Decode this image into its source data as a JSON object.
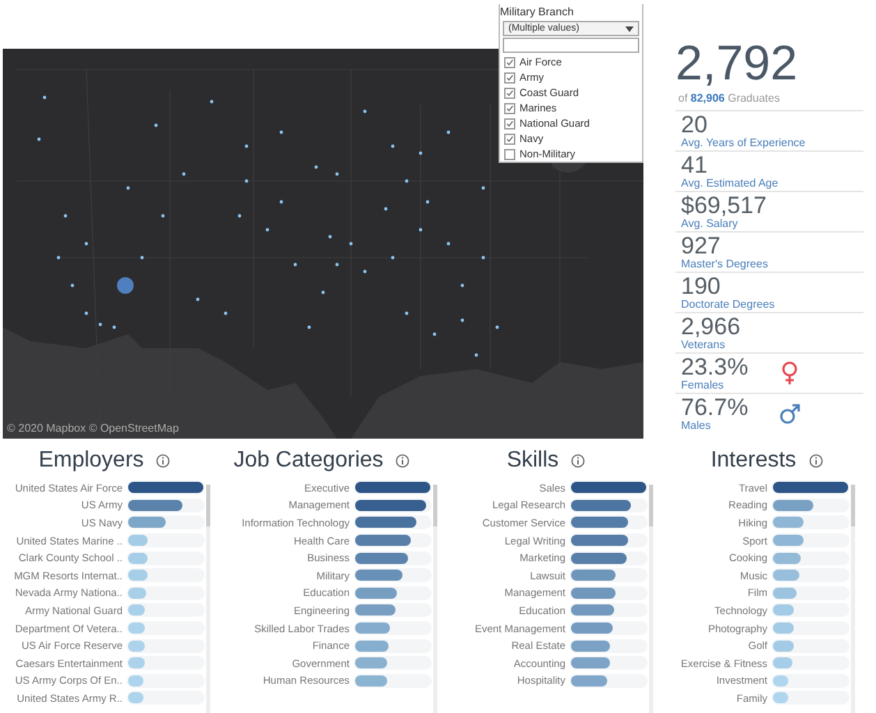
{
  "map": {
    "attribution": "© 2020 Mapbox © OpenStreetMap"
  },
  "filter": {
    "title": "Military Branch",
    "value": "(Multiple values)",
    "options": [
      {
        "label": "Air Force",
        "checked": true
      },
      {
        "label": "Army",
        "checked": true
      },
      {
        "label": "Coast Guard",
        "checked": true
      },
      {
        "label": "Marines",
        "checked": true
      },
      {
        "label": "National Guard",
        "checked": true
      },
      {
        "label": "Navy",
        "checked": true
      },
      {
        "label": "Non-Military",
        "checked": false
      }
    ]
  },
  "summary": {
    "total": "2,792",
    "caption": "of **82,906** Graduates"
  },
  "metrics": [
    {
      "value": "20",
      "label": "Avg. Years of Experience",
      "kind": "plain"
    },
    {
      "value": "41",
      "label": "Avg. Estimated Age",
      "kind": "plain"
    },
    {
      "value": "$69,517",
      "label": "Avg. Salary",
      "kind": "plain"
    },
    {
      "value": "927",
      "label": "Master's Degrees",
      "kind": "plain"
    },
    {
      "value": "190",
      "label": "Doctorate Degrees",
      "kind": "plain"
    },
    {
      "value": "2,966",
      "label": "Veterans",
      "kind": "plain"
    },
    {
      "value": "23.3%",
      "label": "Females",
      "kind": "female"
    },
    {
      "value": "76.7%",
      "label": "Males",
      "kind": "male"
    }
  ],
  "panels": [
    {
      "title": "Employers",
      "items": [
        {
          "label": "United States Air Force",
          "level": 1.0
        },
        {
          "label": "US Army",
          "level": 0.72
        },
        {
          "label": "US Navy",
          "level": 0.5
        },
        {
          "label": "United States Marine ..",
          "level": 0.26
        },
        {
          "label": "Clark County School ..",
          "level": 0.25
        },
        {
          "label": "MGM Resorts Internat..",
          "level": 0.25
        },
        {
          "label": "Nevada Army Nationa..",
          "level": 0.24
        },
        {
          "label": "Army National Guard",
          "level": 0.23
        },
        {
          "label": "Department Of Vetera..",
          "level": 0.22
        },
        {
          "label": "US Air Force Reserve",
          "level": 0.22
        },
        {
          "label": "Caesars Entertainment",
          "level": 0.22
        },
        {
          "label": "US Army Corps Of En..",
          "level": 0.21
        },
        {
          "label": "United States Army R..",
          "level": 0.21
        }
      ]
    },
    {
      "title": "Job Categories",
      "items": [
        {
          "label": "Executive",
          "level": 1.0
        },
        {
          "label": "Management",
          "level": 0.94
        },
        {
          "label": "Information Technology",
          "level": 0.82
        },
        {
          "label": "Health Care",
          "level": 0.74
        },
        {
          "label": "Business",
          "level": 0.71
        },
        {
          "label": "Military",
          "level": 0.63
        },
        {
          "label": "Education",
          "level": 0.55
        },
        {
          "label": "Engineering",
          "level": 0.54
        },
        {
          "label": "Skilled Labor Trades",
          "level": 0.46
        },
        {
          "label": "Finance",
          "level": 0.45
        },
        {
          "label": "Government",
          "level": 0.43
        },
        {
          "label": "Human Resources",
          "level": 0.42
        }
      ]
    },
    {
      "title": "Skills",
      "items": [
        {
          "label": "Sales",
          "level": 1.0
        },
        {
          "label": "Legal Research",
          "level": 0.8
        },
        {
          "label": "Customer Service",
          "level": 0.75
        },
        {
          "label": "Legal Writing",
          "level": 0.75
        },
        {
          "label": "Marketing",
          "level": 0.74
        },
        {
          "label": "Lawsuit",
          "level": 0.6
        },
        {
          "label": "Management",
          "level": 0.59
        },
        {
          "label": "Education",
          "level": 0.57
        },
        {
          "label": "Event Management",
          "level": 0.56
        },
        {
          "label": "Real Estate",
          "level": 0.52
        },
        {
          "label": "Accounting",
          "level": 0.51
        },
        {
          "label": "Hospitality",
          "level": 0.49
        }
      ]
    },
    {
      "title": "Interests",
      "items": [
        {
          "label": "Travel",
          "level": 1.0
        },
        {
          "label": "Reading",
          "level": 0.53
        },
        {
          "label": "Hiking",
          "level": 0.4
        },
        {
          "label": "Sport",
          "level": 0.4
        },
        {
          "label": "Cooking",
          "level": 0.37
        },
        {
          "label": "Music",
          "level": 0.35
        },
        {
          "label": "Film",
          "level": 0.32
        },
        {
          "label": "Technology",
          "level": 0.27
        },
        {
          "label": "Photography",
          "level": 0.27
        },
        {
          "label": "Golf",
          "level": 0.27
        },
        {
          "label": "Exercise & Fitness",
          "level": 0.25
        },
        {
          "label": "Investment",
          "level": 0.2
        },
        {
          "label": "Family",
          "level": 0.2
        }
      ]
    }
  ]
}
